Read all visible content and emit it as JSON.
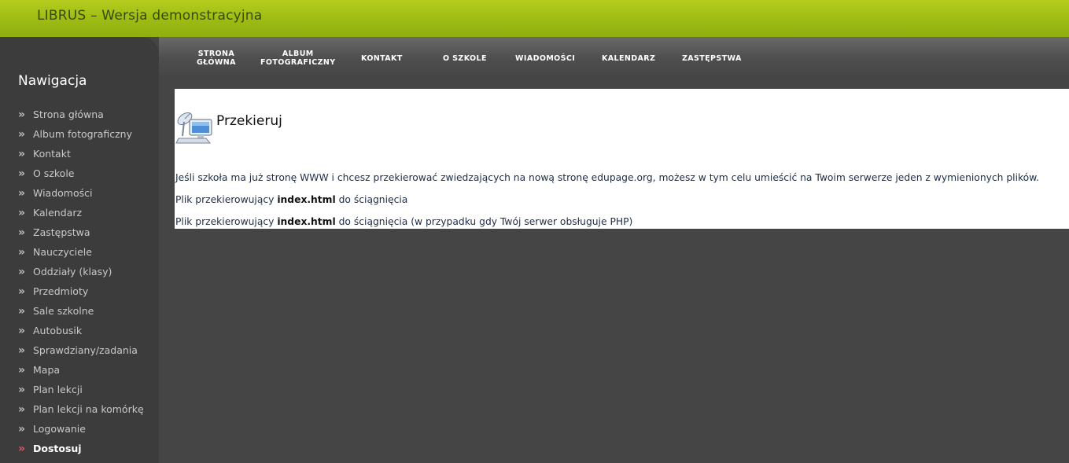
{
  "header": {
    "title": "LIBRUS – Wersja demonstracyjna"
  },
  "sidebar": {
    "heading": "Nawigacja",
    "items": [
      {
        "label": "Strona główna"
      },
      {
        "label": "Album fotograficzny"
      },
      {
        "label": "Kontakt"
      },
      {
        "label": "O szkole"
      },
      {
        "label": "Wiadomości"
      },
      {
        "label": "Kalendarz"
      },
      {
        "label": "Zastępstwa"
      },
      {
        "label": "Nauczyciele"
      },
      {
        "label": "Oddziały (klasy)"
      },
      {
        "label": "Przedmioty"
      },
      {
        "label": "Sale szkolne"
      },
      {
        "label": "Autobusik"
      },
      {
        "label": "Sprawdziany/zadania"
      },
      {
        "label": "Mapa"
      },
      {
        "label": "Plan lekcji"
      },
      {
        "label": "Plan lekcji na komórkę"
      },
      {
        "label": "Logowanie"
      },
      {
        "label": "Dostosuj",
        "active": true
      }
    ],
    "bullet": "»"
  },
  "topnav": {
    "items": [
      {
        "label": "STRONA\nGŁÓWNA"
      },
      {
        "label": "ALBUM\nFOTOGRAFICZNY"
      },
      {
        "label": "KONTAKT"
      },
      {
        "label": "O SZKOLE"
      },
      {
        "label": "WIADOMOŚCI"
      },
      {
        "label": "KALENDARZ"
      },
      {
        "label": "ZASTĘPSTWA"
      }
    ]
  },
  "content": {
    "icon": "redirect-computer-icon",
    "title": "Przekieruj",
    "intro": "Jeśli szkoła ma już stronę WWW i chcesz przekierować zwiedzających na nową stronę edupage.org, możesz w tym celu umieścić na Twoim serwerze jeden z wymienionych plików.",
    "link1": {
      "prefix": "Plik przekierowujący ",
      "file": "index.html",
      "suffix": " do ściągnięcia"
    },
    "link2": {
      "prefix": "Plik przekierowujący ",
      "file": "index.html",
      "suffix": " do ściągnięcia (w przypadku gdy Twój serwer obsługuje PHP)"
    }
  },
  "colors": {
    "header_green": "#9dbb14",
    "sidebar_bg": "#3c3c3c",
    "page_bg": "#454545",
    "active_bullet": "#e0556e"
  }
}
